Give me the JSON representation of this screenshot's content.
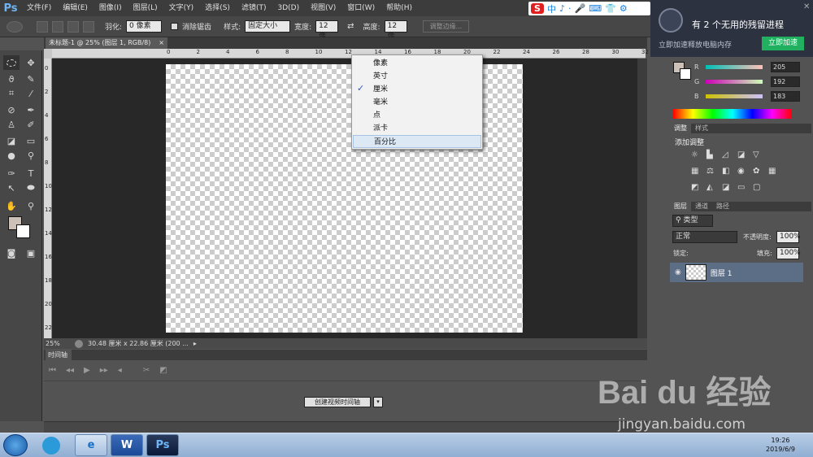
{
  "app": {
    "logo": "Ps"
  },
  "menu": [
    "文件(F)",
    "编辑(E)",
    "图像(I)",
    "图层(L)",
    "文字(Y)",
    "选择(S)",
    "滤镜(T)",
    "3D(D)",
    "视图(V)",
    "窗口(W)",
    "帮助(H)"
  ],
  "ime": {
    "items": [
      "中",
      "♪",
      "·",
      "🎤",
      "⌨",
      "👕",
      "⚙"
    ]
  },
  "options_bar": {
    "feather_label": "羽化:",
    "feather_value": "0 像素",
    "antialias_label": "消除锯齿",
    "style_label": "样式:",
    "style_value": "固定大小",
    "width_label": "宽度:",
    "width_value": "12 像",
    "height_label": "高度:",
    "height_value": "12 像",
    "refine_edge": "调整边缘..."
  },
  "document": {
    "tab_title": "未标题-1 @ 25% (图层 1, RGB/8)",
    "zoom": "25%",
    "doc_size": "30.48 厘米 x 22.86 厘米 (200 ..."
  },
  "ruler": {
    "h_ticks": [
      "0",
      "2",
      "4",
      "6",
      "8",
      "10",
      "12",
      "14",
      "16",
      "18",
      "20",
      "22",
      "24",
      "26",
      "28",
      "30",
      "32",
      "34",
      "36",
      "38"
    ],
    "v_ticks": [
      "0",
      "2",
      "4",
      "6",
      "8",
      "10",
      "12",
      "14",
      "16",
      "18",
      "20",
      "22"
    ]
  },
  "unit_menu": {
    "items": [
      "像素",
      "英寸",
      "厘米",
      "毫米",
      "点",
      "派卡",
      "百分比"
    ],
    "checked_index": 2,
    "highlighted_index": 6,
    "check_mark": "✓"
  },
  "timeline": {
    "tab": "时间轴",
    "create_button": "创建视频时间轴",
    "dropdown_arrow": "▾"
  },
  "notification": {
    "title": "有 2 个无用的残留进程",
    "subtitle": "立即加速释放电脑内存",
    "button": "立即加速",
    "close": "✕"
  },
  "color_panel": {
    "r_label": "R",
    "r_value": "205",
    "g_label": "G",
    "g_value": "192",
    "b_label": "B",
    "b_value": "183"
  },
  "adjustments_panel": {
    "tabs": [
      "调整",
      "样式"
    ],
    "title": "添加调整"
  },
  "layers_panel": {
    "tabs": [
      "图层",
      "通道",
      "路径"
    ],
    "filter_label": "类型",
    "blend_mode": "正常",
    "opacity_label": "不透明度:",
    "opacity_value": "100%",
    "lock_label": "锁定:",
    "fill_label": "填充:",
    "fill_value": "100%",
    "layer_name": "图层 1"
  },
  "taskbar": {
    "time": "19:26",
    "date": "2019/6/9",
    "apps": [
      "e",
      "W",
      "Ps"
    ]
  },
  "watermark": {
    "logo": "Bai du 经验",
    "url": "jingyan.baidu.com"
  }
}
